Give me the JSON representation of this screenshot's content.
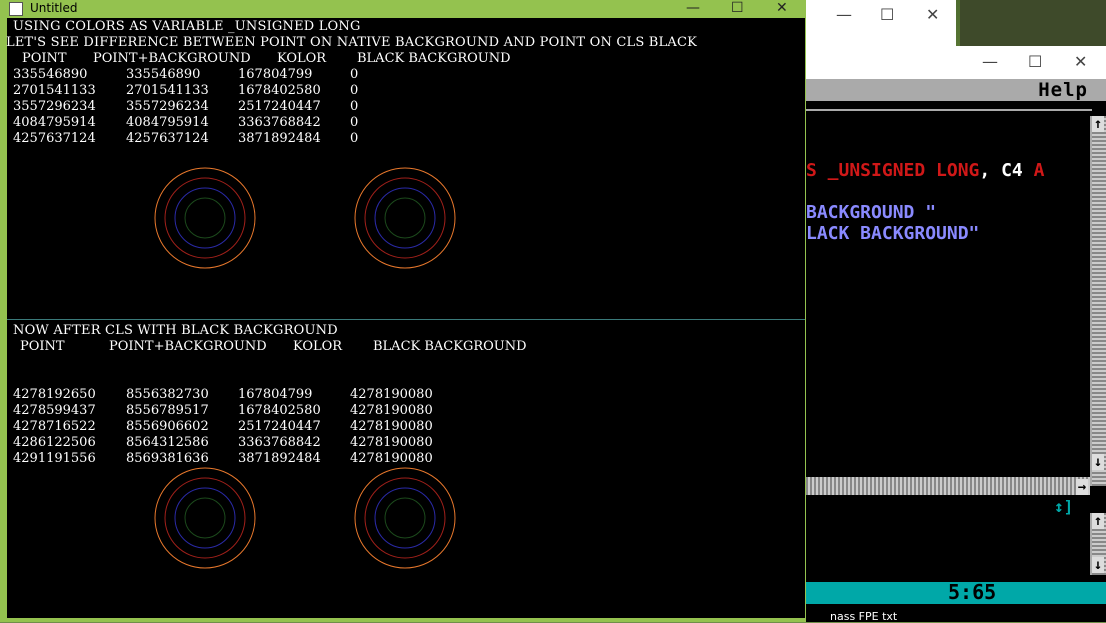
{
  "window": {
    "title": "Untitled",
    "minimize": "—",
    "maximize": "☐",
    "close": "✕"
  },
  "section1": {
    "line1": "USING COLORS AS VARIABLE _UNSIGNED LONG",
    "line2": "LET'S SEE DIFFERENCE BETWEEN POINT ON NATIVE BACKGROUND AND POINT ON CLS BLACK",
    "headers": [
      "POINT",
      "POINT+BACKGROUND",
      "KOLOR",
      "BLACK BACKGROUND"
    ],
    "rows": [
      [
        "335546890",
        "335546890",
        "167804799",
        "0"
      ],
      [
        "2701541133",
        "2701541133",
        "1678402580",
        "0"
      ],
      [
        "3557296234",
        "3557296234",
        "2517240447",
        "0"
      ],
      [
        "4084795914",
        "4084795914",
        "3363768842",
        "0"
      ],
      [
        "4257637124",
        "4257637124",
        "3871892484",
        "0"
      ]
    ]
  },
  "section2": {
    "line1": "NOW AFTER CLS WITH BLACK BACKGROUND",
    "headers": [
      "POINT",
      "POINT+BACKGROUND",
      "KOLOR",
      "BLACK BACKGROUND"
    ],
    "rows": [
      [
        "4278192650",
        "8556382730",
        "167804799",
        "4278190080"
      ],
      [
        "4278599437",
        "8556789517",
        "1678402580",
        "4278190080"
      ],
      [
        "4278716522",
        "8556906602",
        "2517240447",
        "4278190080"
      ],
      [
        "4286122506",
        "8564312586",
        "3363768842",
        "4278190080"
      ],
      [
        "4291191556",
        "8569381636",
        "3871892484",
        "4278190080"
      ]
    ]
  },
  "editor": {
    "menu_help": "Help",
    "code_line1_a": "S _UNSIGNED LONG",
    "code_line1_b": ", ",
    "code_line1_c": "C4",
    "code_line1_d": " A",
    "code_line2": "BACKGROUND \"",
    "code_line3": "LACK BACKGROUND\"",
    "status_position": "5:65",
    "cursor_glyph": "↕]"
  },
  "taskbar": {
    "file_label": "nass FPE txt"
  },
  "colors": {
    "accent_titlebar": "#94c24f",
    "qb_blue": "#0000aa",
    "qb_status": "#00a8a8",
    "circle_orange": "#e8782c",
    "circle_red": "#a0201a",
    "circle_blue": "#2a2aa8",
    "circle_green": "#1c4a1c"
  }
}
